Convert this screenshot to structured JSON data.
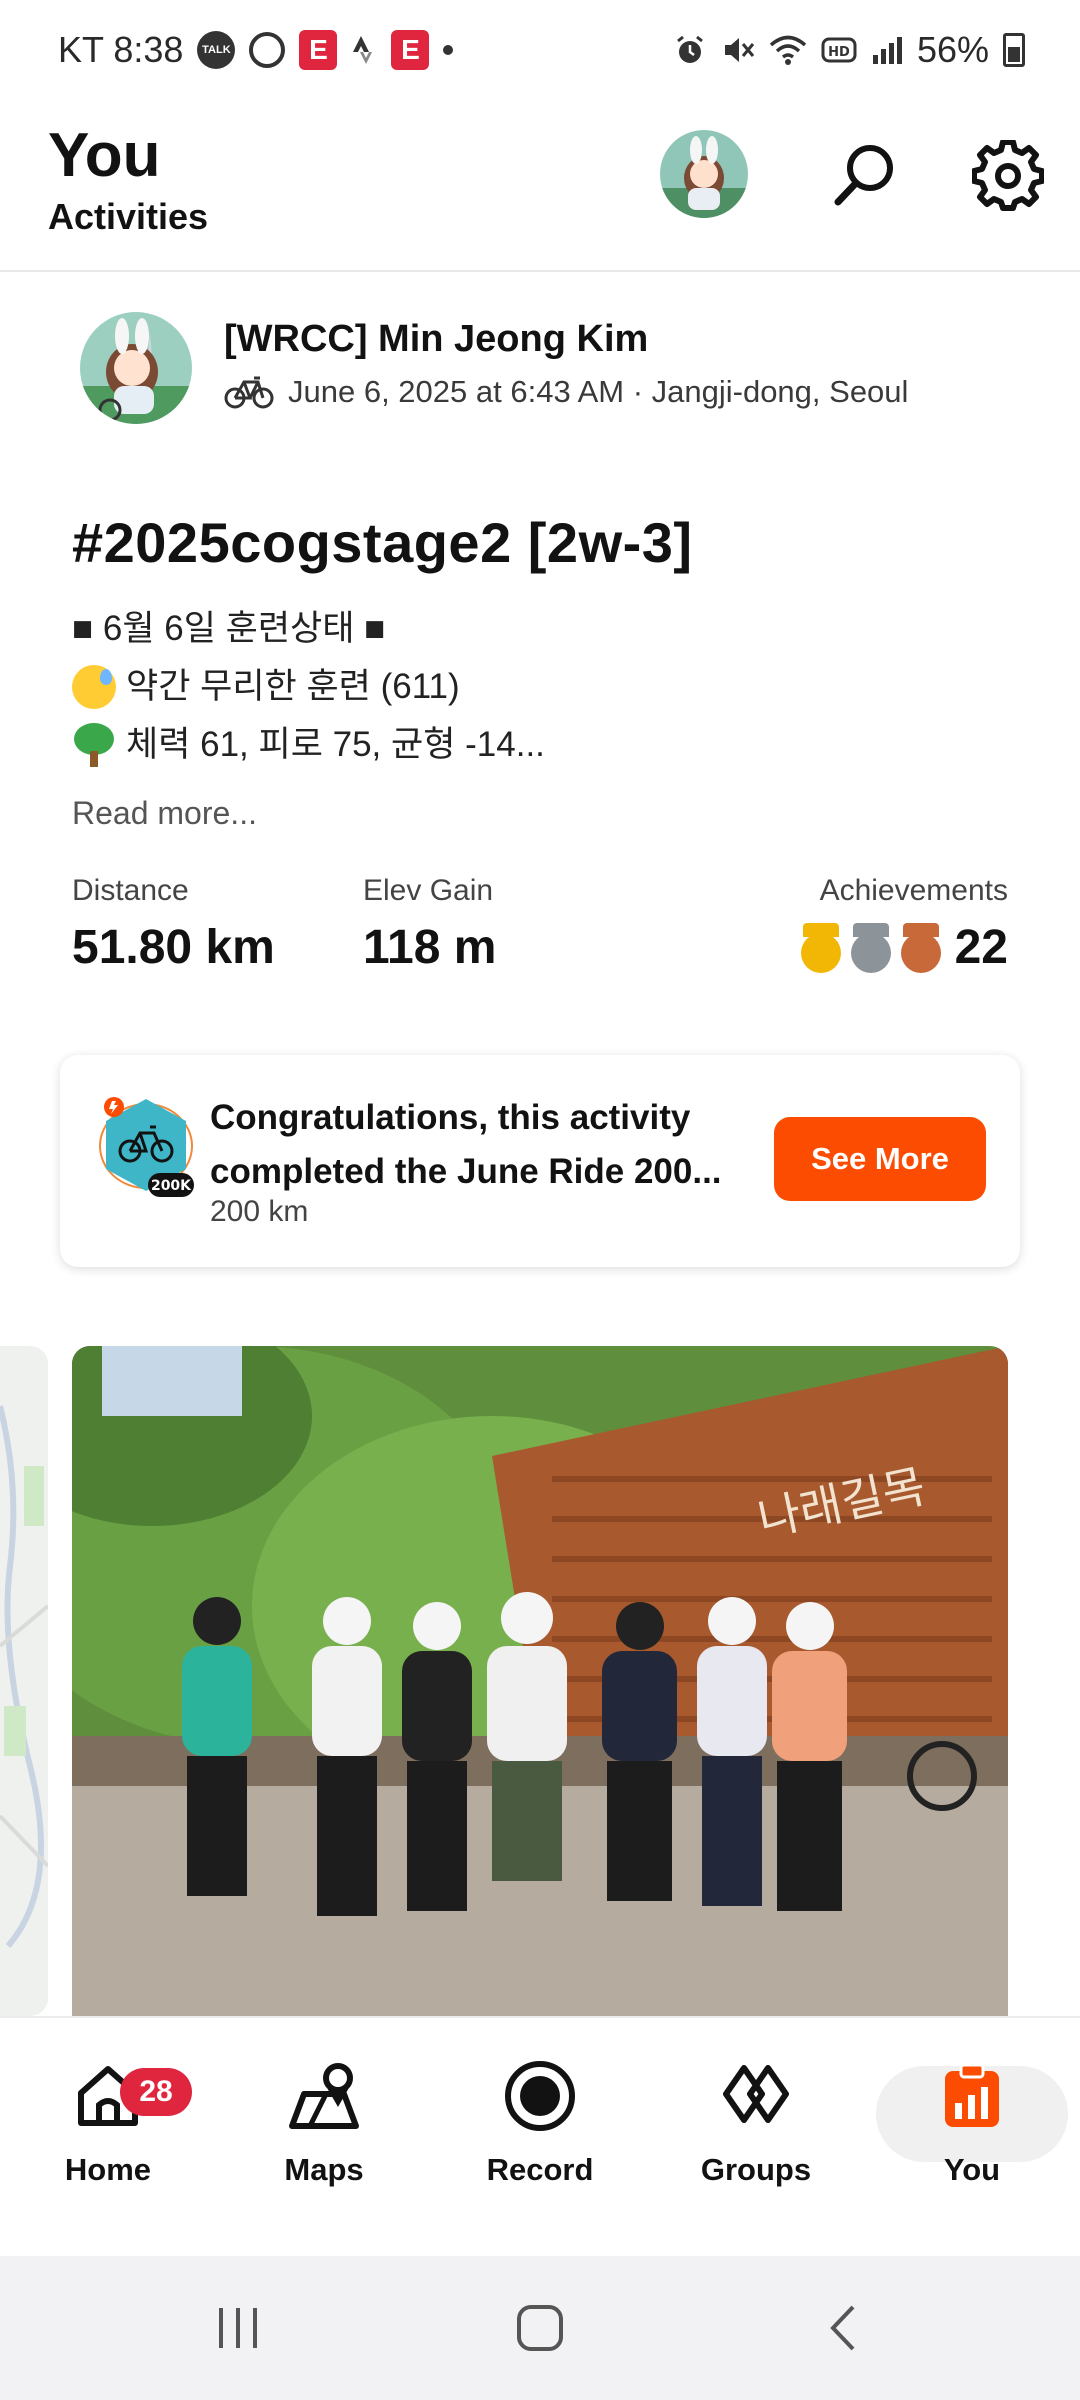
{
  "status_bar": {
    "carrier_time": "KT 8:38",
    "talk_label": "TALK",
    "app_letter": "E",
    "battery": "56%",
    "icons": [
      "talk-icon",
      "ring-icon",
      "red-app-icon",
      "strava-icon",
      "alarm-icon",
      "mute-icon",
      "wifi-icon",
      "hd-icon",
      "signal-icon",
      "battery-icon"
    ]
  },
  "header": {
    "title": "You",
    "subtitle": "Activities"
  },
  "activity": {
    "athlete_name": "[WRCC] Min Jeong Kim",
    "sport_icon": "bike-icon",
    "meta": "June 6, 2025 at 6:43 AM · Jangji-dong, Seoul",
    "title": "#2025cogstage2 [2w-3]",
    "description": {
      "line1": "■ 6월 6일 훈련상태 ■",
      "line2": "약간 무리한 훈련 (611)",
      "line3": "체력 61, 피로 75, 균형 -14..."
    },
    "read_more": "Read more...",
    "stats": {
      "distance_label": "Distance",
      "distance_value": "51.80 km",
      "elev_label": "Elev Gain",
      "elev_value": "118 m",
      "achievements_label": "Achievements",
      "achievements_count": "22",
      "medal_colors": [
        "#f2b705",
        "#8c9499",
        "#c8693a"
      ]
    }
  },
  "challenge": {
    "title": "Congratulations, this activity completed the June Ride 200...",
    "subtitle": "200 km",
    "badge_label": "200K",
    "button_label": "See More",
    "accent": "#fc4c02"
  },
  "media": {
    "photo_sign_text": "나래길목"
  },
  "bottom_nav": {
    "items": [
      {
        "label": "Home",
        "icon": "home-icon"
      },
      {
        "label": "Maps",
        "icon": "maps-icon"
      },
      {
        "label": "Record",
        "icon": "record-icon"
      },
      {
        "label": "Groups",
        "icon": "groups-icon"
      },
      {
        "label": "You",
        "icon": "you-icon"
      }
    ],
    "home_badge": "28",
    "active": "You"
  }
}
